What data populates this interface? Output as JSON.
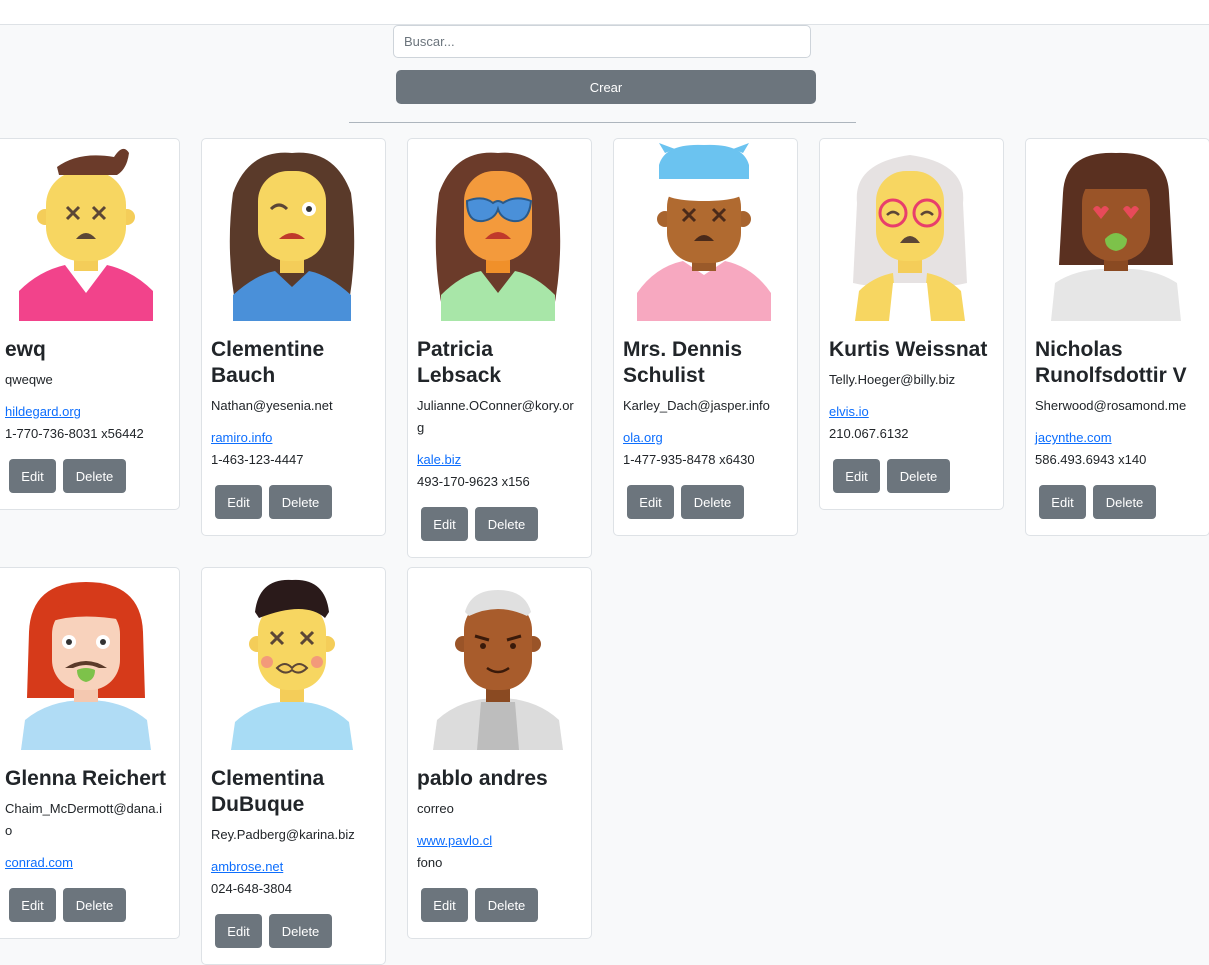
{
  "search": {
    "placeholder": "Buscar..."
  },
  "create_label": "Crear",
  "buttons": {
    "edit": "Edit",
    "delete": "Delete"
  },
  "cards": [
    {
      "name": "ewq",
      "email": "qweqwe",
      "website": "hildegard.org",
      "phone": "1-770-736-8031 x56442"
    },
    {
      "name": "Clementine Bauch",
      "email": "Nathan@yesenia.net",
      "website": "ramiro.info",
      "phone": "1-463-123-4447"
    },
    {
      "name": "Patricia Lebsack",
      "email": "Julianne.OConner@kory.org",
      "website": "kale.biz",
      "phone": "493-170-9623 x156"
    },
    {
      "name": "Mrs. Dennis Schulist",
      "email": "Karley_Dach@jasper.info",
      "website": "ola.org",
      "phone": "1-477-935-8478 x6430"
    },
    {
      "name": "Kurtis Weissnat",
      "email": "Telly.Hoeger@billy.biz",
      "website": "elvis.io",
      "phone": "210.067.6132"
    },
    {
      "name": "Nicholas Runolfsdottir V",
      "email": "Sherwood@rosamond.me",
      "website": "jacynthe.com",
      "phone": "586.493.6943 x140"
    },
    {
      "name": "Glenna Reichert",
      "email": "Chaim_McDermott@dana.io",
      "website": "conrad.com",
      "phone": ""
    },
    {
      "name": "Clementina DuBuque",
      "email": "Rey.Padberg@karina.biz",
      "website": "ambrose.net",
      "phone": "024-648-3804"
    },
    {
      "name": "pablo andres",
      "email": "correo",
      "website": "www.pavlo.cl",
      "phone": "fono"
    }
  ]
}
